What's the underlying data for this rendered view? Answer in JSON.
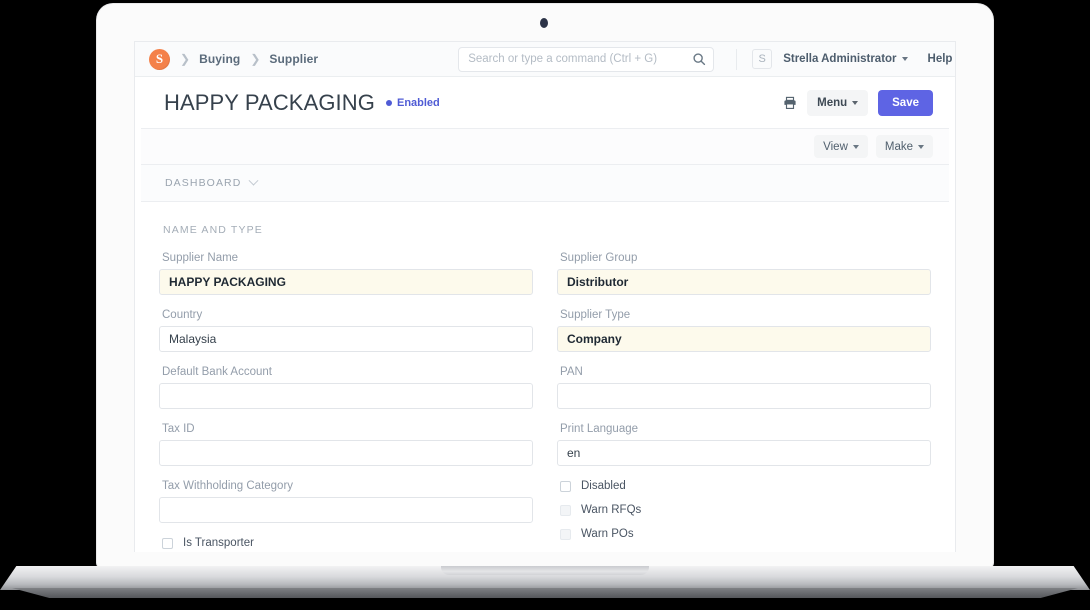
{
  "navbar": {
    "logo_letter": "S",
    "breadcrumb": [
      {
        "label": "Buying"
      },
      {
        "label": "Supplier"
      }
    ],
    "search": {
      "value": "",
      "placeholder": "Search or type a command (Ctrl + G)"
    },
    "avatar_letter": "S",
    "user_name": "Strella Administrator",
    "help_label": "Help"
  },
  "title": {
    "page_title": "HAPPY PACKAGING",
    "status_label": "Enabled",
    "status_color": "#4f5bd5",
    "menu_label": "Menu",
    "save_label": "Save"
  },
  "toolbar": {
    "view_label": "View",
    "make_label": "Make"
  },
  "section": {
    "label": "DASHBOARD"
  },
  "form": {
    "section_title": "NAME AND TYPE",
    "left_fields": [
      {
        "label": "Supplier Name",
        "value": "HAPPY PACKAGING",
        "dirty": true
      },
      {
        "label": "Country",
        "value": "Malaysia",
        "dirty": false
      },
      {
        "label": "Default Bank Account",
        "value": "",
        "dirty": false
      },
      {
        "label": "Tax ID",
        "value": "",
        "dirty": false
      },
      {
        "label": "Tax Withholding Category",
        "value": "",
        "dirty": false
      }
    ],
    "left_checkboxes": [
      {
        "label": "Is Transporter",
        "checked": false,
        "ghost": false
      }
    ],
    "right_fields": [
      {
        "label": "Supplier Group",
        "value": "Distributor",
        "dirty": true
      },
      {
        "label": "Supplier Type",
        "value": "Company",
        "dirty": true
      },
      {
        "label": "PAN",
        "value": "",
        "dirty": false
      },
      {
        "label": "Print Language",
        "value": "en",
        "dirty": false
      }
    ],
    "right_checkboxes": [
      {
        "label": "Disabled",
        "checked": false,
        "ghost": false
      },
      {
        "label": "Warn RFQs",
        "checked": false,
        "ghost": true
      },
      {
        "label": "Warn POs",
        "checked": false,
        "ghost": true
      }
    ]
  }
}
